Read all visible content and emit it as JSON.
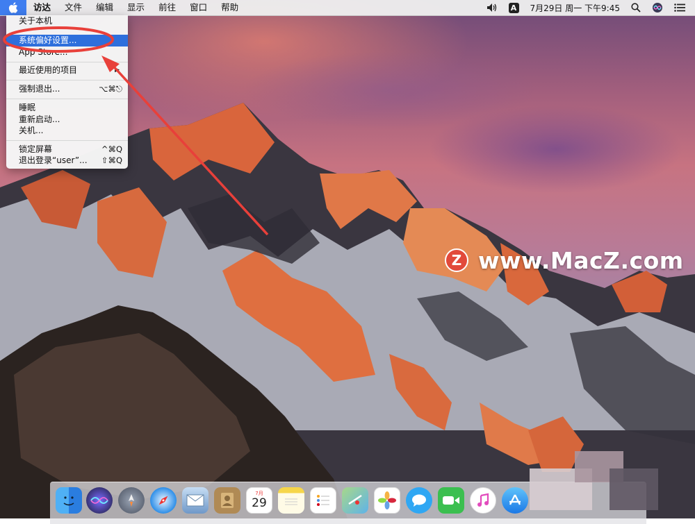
{
  "menubar": {
    "apple_icon": "apple-logo-icon",
    "menus": [
      "访达",
      "文件",
      "编辑",
      "显示",
      "前往",
      "窗口",
      "帮助"
    ],
    "input_source": "A",
    "clock": "7月29日 周一 下午9:45",
    "status_icons": [
      "volume-icon",
      "input-source-icon",
      "search-icon",
      "siri-icon",
      "notification-center-icon"
    ]
  },
  "apple_menu": {
    "items": [
      {
        "label": "关于本机",
        "shortcut": ""
      },
      {
        "label": "系统偏好设置...",
        "shortcut": "",
        "selected": true
      },
      {
        "label": "App Store...",
        "shortcut": ""
      },
      {
        "label": "最近使用的项目",
        "shortcut": "",
        "submenu": true
      },
      {
        "label": "强制退出...",
        "shortcut": "⌥⌘⎋"
      },
      {
        "label": "睡眠",
        "shortcut": ""
      },
      {
        "label": "重新启动...",
        "shortcut": ""
      },
      {
        "label": "关机...",
        "shortcut": ""
      },
      {
        "label": "锁定屏幕",
        "shortcut": "^⌘Q"
      },
      {
        "label": "退出登录“user”...",
        "shortcut": "⇧⌘Q"
      }
    ]
  },
  "watermark": {
    "logo_letter": "Z",
    "text": "www.MacZ.com"
  },
  "dock": {
    "calendar_month": "7月",
    "calendar_day": "29",
    "icons": [
      "finder-icon",
      "siri-icon",
      "launchpad-icon",
      "safari-icon",
      "mail-icon",
      "contacts-icon",
      "calendar-icon",
      "notes-icon",
      "reminders-icon",
      "maps-icon",
      "photos-icon",
      "messages-icon",
      "facetime-icon",
      "itunes-icon",
      "app-store-icon"
    ]
  },
  "colors": {
    "selection_blue": "#2e6fdc",
    "annotation_red": "#e8403a",
    "apple_button_blue": "#3f7ef0"
  }
}
